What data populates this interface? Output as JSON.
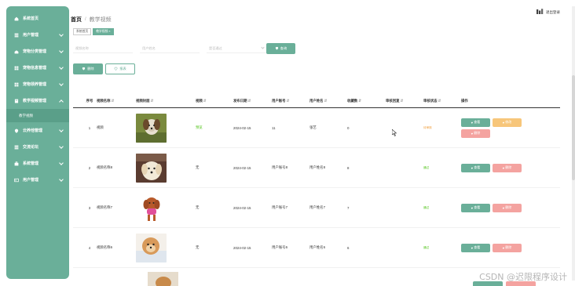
{
  "sidebar": {
    "items": [
      {
        "label": "系统首页",
        "icon": "home-icon",
        "has_chevron": false
      },
      {
        "label": "用户管理",
        "icon": "list-icon",
        "has_chevron": true
      },
      {
        "label": "宠物分类管理",
        "icon": "paw-icon",
        "has_chevron": true
      },
      {
        "label": "宠物信息管理",
        "icon": "grid-icon",
        "has_chevron": true
      },
      {
        "label": "宠物领养管理",
        "icon": "grid-icon",
        "has_chevron": true
      },
      {
        "label": "教学视频管理",
        "icon": "book-icon",
        "has_chevron": true,
        "expanded": true
      }
    ],
    "subitems": [
      {
        "label": "教学视频"
      }
    ],
    "items_after": [
      {
        "label": "云养他管理",
        "icon": "pin-icon",
        "has_chevron": true
      },
      {
        "label": "交流论坛",
        "icon": "list-icon",
        "has_chevron": true
      },
      {
        "label": "系统管理",
        "icon": "briefcase-icon",
        "has_chevron": true
      },
      {
        "label": "用户管理",
        "icon": "card-icon",
        "has_chevron": true
      }
    ]
  },
  "header": {
    "crumb_home": "首页",
    "crumb_sep": "/",
    "crumb_current": "教学视频",
    "logout": "退出登录"
  },
  "tags": [
    {
      "label": "系统首页",
      "active": false
    },
    {
      "label": "教学视频 ×",
      "active": true
    }
  ],
  "search": {
    "video_name_placeholder": "视频名称",
    "username_placeholder": "用户姓名",
    "status_placeholder": "是否通过",
    "search_label": "查询"
  },
  "actions": {
    "delete_label": "删除",
    "report_label": "报表"
  },
  "table": {
    "headers": {
      "idx": "序号",
      "name": "视频名称",
      "cover": "视频封面",
      "video": "视频",
      "date": "发布日期",
      "acct": "用户账号",
      "uname": "用户姓名",
      "fav": "收藏数",
      "reply": "审核回复",
      "status": "审核状态",
      "ops": "操作"
    },
    "ops_labels": {
      "view": "查看",
      "edit": "修改",
      "del": "删除"
    },
    "rows": [
      {
        "idx": "1",
        "name": "视频",
        "cover": "dog-1",
        "video": "预览",
        "date": "2024-02-15",
        "acct": "11",
        "uname": "张艺",
        "fav": "0",
        "reply": "",
        "status": "待审核",
        "status_type": "wait",
        "show_edit": true
      },
      {
        "idx": "2",
        "name": "视频名称8",
        "cover": "dog-2",
        "video": "无",
        "date": "2024-02-15",
        "acct": "用户账号8",
        "uname": "用户姓名8",
        "fav": "8",
        "reply": "",
        "status": "通过",
        "status_type": "ok",
        "show_edit": false
      },
      {
        "idx": "3",
        "name": "视频名称7",
        "cover": "dog-3",
        "video": "无",
        "date": "2024-02-15",
        "acct": "用户账号7",
        "uname": "用户姓名7",
        "fav": "7",
        "reply": "",
        "status": "通过",
        "status_type": "ok",
        "show_edit": false
      },
      {
        "idx": "4",
        "name": "视频名称6",
        "cover": "dog-4",
        "video": "无",
        "date": "2024-02-15",
        "acct": "用户账号6",
        "uname": "用户姓名6",
        "fav": "6",
        "reply": "",
        "status": "通过",
        "status_type": "ok",
        "show_edit": false
      }
    ]
  },
  "watermark": "CSDN @迟限程序设计",
  "colors": {
    "accent": "#6aaf99",
    "edit": "#f7c67a",
    "del": "#f4a3a0",
    "ok": "#52c41a",
    "wait": "#f0a040"
  }
}
